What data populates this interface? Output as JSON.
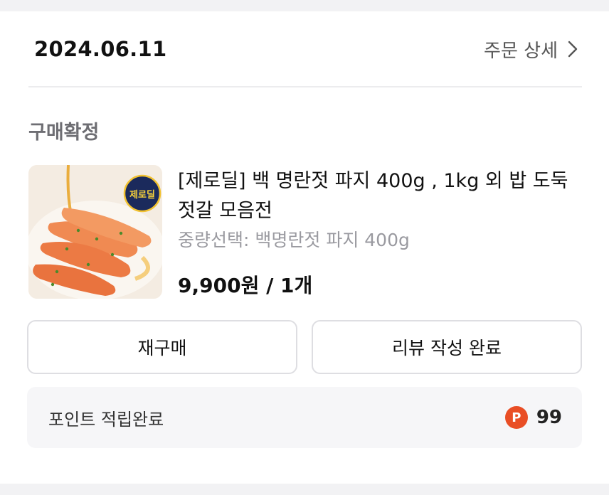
{
  "order": {
    "date": "2024.06.11",
    "detail_link_label": "주문 상세",
    "status": "구매확정"
  },
  "product": {
    "title": "[제로딜] 백 명란젓 파지 400g , 1kg 외 밥 도둑 젓갈 모음전",
    "option": "중량선택: 백명란젓 파지 400g",
    "price_qty": "9,900원 / 1개",
    "thumbnail_logo_text": "제로딜"
  },
  "actions": {
    "rebuy_label": "재구매",
    "review_label": "리뷰 작성 완료"
  },
  "points": {
    "label": "포인트 적립완료",
    "badge": "P",
    "value": "99"
  },
  "colors": {
    "points_badge": "#e94e25",
    "status_text": "#6e6e73",
    "option_text": "#9a9aa0"
  }
}
